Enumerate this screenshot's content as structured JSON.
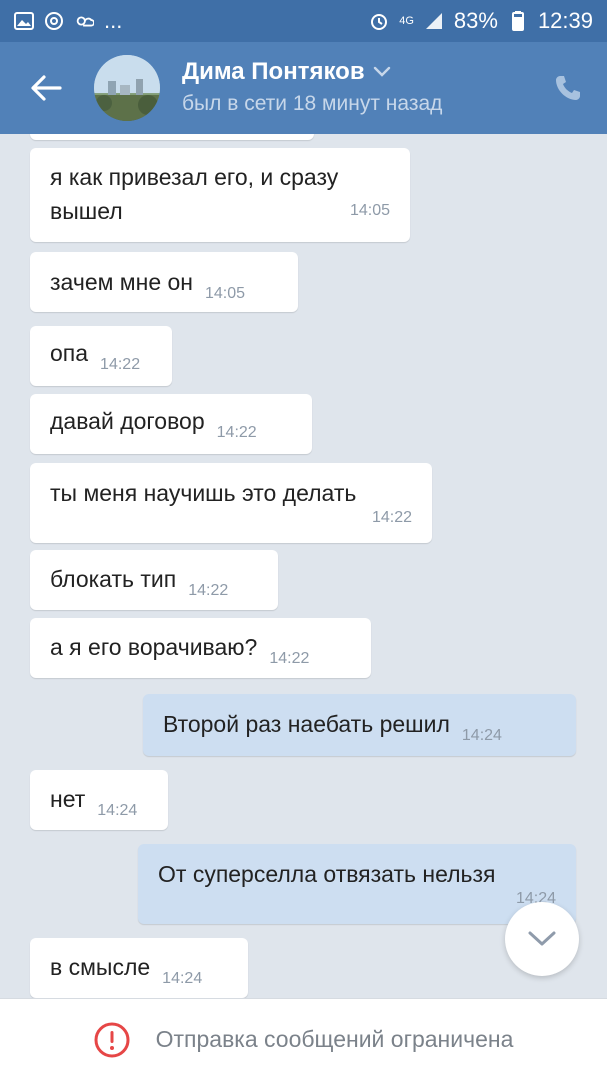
{
  "statusbar": {
    "left_icons": [
      "image-icon",
      "at-icon",
      "weather-icon"
    ],
    "more": "...",
    "network": "4G",
    "battery": "83%",
    "time": "12:39"
  },
  "header": {
    "contact_name": "Дима Понтяков",
    "status": "был в сети 18 минут назад",
    "back_icon": "arrow-left-icon",
    "call_icon": "phone-icon",
    "dropdown_icon": "chevron-down-icon"
  },
  "messages": [
    {
      "direction": "in",
      "text": "я как привезал его, и сразу вышел",
      "line1": "я как привезал его, и сразу",
      "line2": "вышел",
      "time": "14:05"
    },
    {
      "direction": "in",
      "text": "зачем мне он",
      "time": "14:05"
    },
    {
      "direction": "in",
      "text": "опа",
      "time": "14:22"
    },
    {
      "direction": "in",
      "text": "давай договор",
      "time": "14:22"
    },
    {
      "direction": "in",
      "text": "ты меня научишь это делать",
      "time": "14:22"
    },
    {
      "direction": "in",
      "text": "блокать тип",
      "time": "14:22"
    },
    {
      "direction": "in",
      "text": "а я его ворачиваю?",
      "time": "14:22"
    },
    {
      "direction": "out",
      "text": "Второй раз наебать решил",
      "time": "14:24"
    },
    {
      "direction": "in",
      "text": "нет",
      "time": "14:24"
    },
    {
      "direction": "out",
      "text": "От суперселла отвязать нельзя",
      "time": "14:24"
    },
    {
      "direction": "in",
      "text": "в смысле",
      "time": "14:24"
    }
  ],
  "bottom": {
    "restriction_text": "Отправка сообщений ограничена",
    "alert_color": "#e64646"
  },
  "colors": {
    "header_bg": "#5181b8",
    "statusbar_bg": "#3f6fa7",
    "chat_bg": "#dfe5ec",
    "outgoing_bubble": "#cddef1"
  }
}
